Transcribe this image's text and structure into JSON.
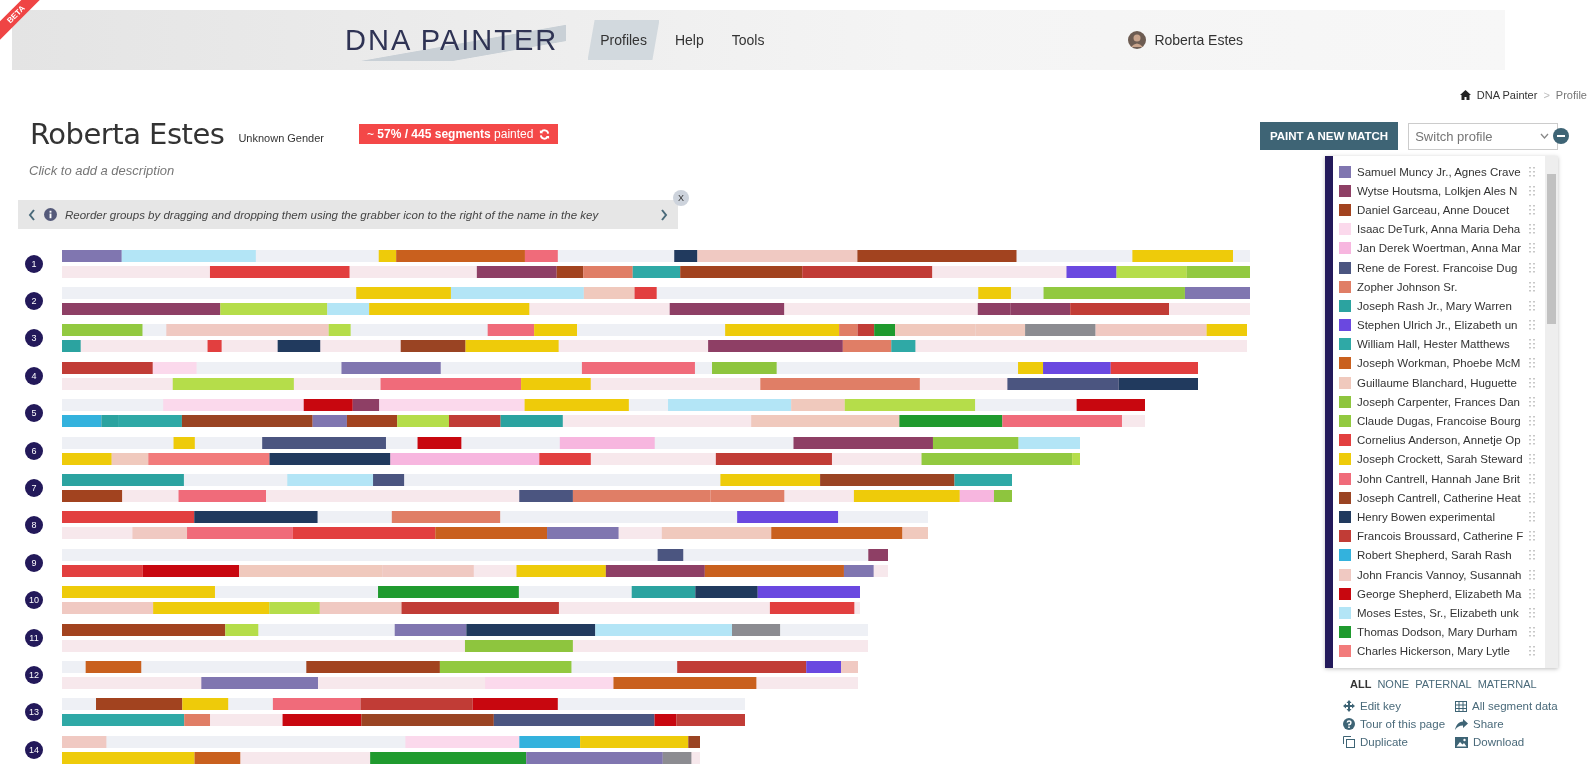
{
  "header": {
    "ribbon": "BETA",
    "logo": "DNA PAINTER",
    "nav": [
      {
        "label": "Profiles",
        "selected": true
      },
      {
        "label": "Help",
        "selected": false
      },
      {
        "label": "Tools",
        "selected": false
      }
    ],
    "user": "Roberta Estes"
  },
  "breadcrumb": {
    "home": "DNA Painter",
    "separator": ">",
    "current": "Profile"
  },
  "profile": {
    "name": "Roberta Estes",
    "gender": "Unknown Gender",
    "progress": "~ **57% / 445 segments** painted",
    "description_placeholder": "Click to add a description"
  },
  "tip": {
    "text": "Reorder groups by dragging and dropping them using the grabber icon to the right of the name in the key",
    "close": "X"
  },
  "chromosomes": [
    {
      "number": "1"
    },
    {
      "number": "2"
    },
    {
      "number": "3"
    },
    {
      "number": "4"
    },
    {
      "number": "5"
    },
    {
      "number": "6"
    },
    {
      "number": "7"
    },
    {
      "number": "8"
    },
    {
      "number": "9"
    },
    {
      "number": "10"
    },
    {
      "number": "11"
    },
    {
      "number": "12"
    },
    {
      "number": "13"
    },
    {
      "number": "14"
    }
  ],
  "paint_button": "PAINT A NEW MATCH",
  "switch_profile": {
    "placeholder": "Switch profile"
  },
  "key": [
    {
      "name": "Samuel Muncy Jr., Agnes Crave",
      "color": "#8076b0"
    },
    {
      "name": "Wytse Houtsma, Lolkjen Ales N",
      "color": "#8e3f65"
    },
    {
      "name": "Daniel Garceau, Anne Doucet",
      "color": "#a2431f"
    },
    {
      "name": "Isaac DeTurk, Anna Maria Deha",
      "color": "#fbd9ec"
    },
    {
      "name": "Jan Derek Woertman, Anna Mar",
      "color": "#f7b6df"
    },
    {
      "name": "Rene de Forest. Francoise Dug",
      "color": "#4b5580"
    },
    {
      "name": "Zopher Johnson Sr.",
      "color": "#e07e66"
    },
    {
      "name": "Joseph Rash Jr., Mary Warren",
      "color": "#2ba3a0"
    },
    {
      "name": "Stephen Ulrich Jr., Elizabeth un",
      "color": "#6a48e0"
    },
    {
      "name": "William Hall, Hester Matthews",
      "color": "#2fa9a6"
    },
    {
      "name": "Joseph Workman, Phoebe McM",
      "color": "#c9601e"
    },
    {
      "name": "Guillaume Blanchard, Huguette",
      "color": "#f0c9bd"
    },
    {
      "name": "Joseph Carpenter, Frances Dan",
      "color": "#8ec53e"
    },
    {
      "name": "Claude Dugas, Francoise Bourg",
      "color": "#92c940"
    },
    {
      "name": "Cornelius Anderson, Annetje Op",
      "color": "#e23f3f"
    },
    {
      "name": "Joseph Crockett, Sarah Steward",
      "color": "#eecb0a"
    },
    {
      "name": "John Cantrell, Hannah Jane Brit",
      "color": "#f06b7a"
    },
    {
      "name": "Joseph Cantrell, Catherine Heat",
      "color": "#9a4423"
    },
    {
      "name": "Henry Bowen experimental",
      "color": "#213a5e"
    },
    {
      "name": "Francois Broussard, Catherine F",
      "color": "#c13c36"
    },
    {
      "name": "Robert Shepherd, Sarah Rash",
      "color": "#33b2dd"
    },
    {
      "name": "John Francis Vannoy, Susannah",
      "color": "#f0c9c2"
    },
    {
      "name": "George Shepherd, Elizabeth Ma",
      "color": "#c8070f"
    },
    {
      "name": "Moses Estes, Sr., Elizabeth unk",
      "color": "#b3e5f6"
    },
    {
      "name": "Thomas Dodson, Mary Durham",
      "color": "#1f9a2e"
    },
    {
      "name": "Charles Hickerson, Mary Lytle",
      "color": "#f27b7b"
    }
  ],
  "filters": [
    {
      "label": "ALL",
      "selected": true
    },
    {
      "label": "NONE",
      "selected": false
    },
    {
      "label": "PATERNAL",
      "selected": false
    },
    {
      "label": "MATERNAL",
      "selected": false
    }
  ],
  "actions": [
    "Edit key",
    "All segment data",
    "Tour of this page",
    "Share",
    "Duplicate",
    "Download"
  ]
}
